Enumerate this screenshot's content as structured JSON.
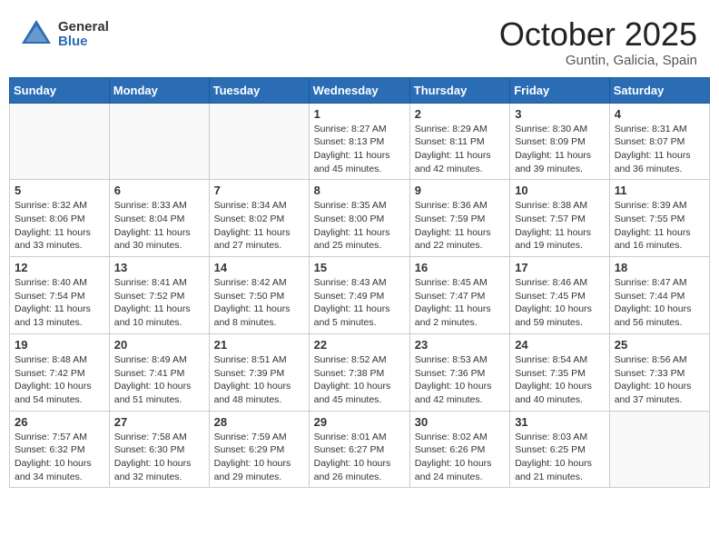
{
  "header": {
    "logo_general": "General",
    "logo_blue": "Blue",
    "month": "October 2025",
    "location": "Guntin, Galicia, Spain"
  },
  "weekdays": [
    "Sunday",
    "Monday",
    "Tuesday",
    "Wednesday",
    "Thursday",
    "Friday",
    "Saturday"
  ],
  "weeks": [
    [
      {
        "day": "",
        "info": ""
      },
      {
        "day": "",
        "info": ""
      },
      {
        "day": "",
        "info": ""
      },
      {
        "day": "1",
        "info": "Sunrise: 8:27 AM\nSunset: 8:13 PM\nDaylight: 11 hours and 45 minutes."
      },
      {
        "day": "2",
        "info": "Sunrise: 8:29 AM\nSunset: 8:11 PM\nDaylight: 11 hours and 42 minutes."
      },
      {
        "day": "3",
        "info": "Sunrise: 8:30 AM\nSunset: 8:09 PM\nDaylight: 11 hours and 39 minutes."
      },
      {
        "day": "4",
        "info": "Sunrise: 8:31 AM\nSunset: 8:07 PM\nDaylight: 11 hours and 36 minutes."
      }
    ],
    [
      {
        "day": "5",
        "info": "Sunrise: 8:32 AM\nSunset: 8:06 PM\nDaylight: 11 hours and 33 minutes."
      },
      {
        "day": "6",
        "info": "Sunrise: 8:33 AM\nSunset: 8:04 PM\nDaylight: 11 hours and 30 minutes."
      },
      {
        "day": "7",
        "info": "Sunrise: 8:34 AM\nSunset: 8:02 PM\nDaylight: 11 hours and 27 minutes."
      },
      {
        "day": "8",
        "info": "Sunrise: 8:35 AM\nSunset: 8:00 PM\nDaylight: 11 hours and 25 minutes."
      },
      {
        "day": "9",
        "info": "Sunrise: 8:36 AM\nSunset: 7:59 PM\nDaylight: 11 hours and 22 minutes."
      },
      {
        "day": "10",
        "info": "Sunrise: 8:38 AM\nSunset: 7:57 PM\nDaylight: 11 hours and 19 minutes."
      },
      {
        "day": "11",
        "info": "Sunrise: 8:39 AM\nSunset: 7:55 PM\nDaylight: 11 hours and 16 minutes."
      }
    ],
    [
      {
        "day": "12",
        "info": "Sunrise: 8:40 AM\nSunset: 7:54 PM\nDaylight: 11 hours and 13 minutes."
      },
      {
        "day": "13",
        "info": "Sunrise: 8:41 AM\nSunset: 7:52 PM\nDaylight: 11 hours and 10 minutes."
      },
      {
        "day": "14",
        "info": "Sunrise: 8:42 AM\nSunset: 7:50 PM\nDaylight: 11 hours and 8 minutes."
      },
      {
        "day": "15",
        "info": "Sunrise: 8:43 AM\nSunset: 7:49 PM\nDaylight: 11 hours and 5 minutes."
      },
      {
        "day": "16",
        "info": "Sunrise: 8:45 AM\nSunset: 7:47 PM\nDaylight: 11 hours and 2 minutes."
      },
      {
        "day": "17",
        "info": "Sunrise: 8:46 AM\nSunset: 7:45 PM\nDaylight: 10 hours and 59 minutes."
      },
      {
        "day": "18",
        "info": "Sunrise: 8:47 AM\nSunset: 7:44 PM\nDaylight: 10 hours and 56 minutes."
      }
    ],
    [
      {
        "day": "19",
        "info": "Sunrise: 8:48 AM\nSunset: 7:42 PM\nDaylight: 10 hours and 54 minutes."
      },
      {
        "day": "20",
        "info": "Sunrise: 8:49 AM\nSunset: 7:41 PM\nDaylight: 10 hours and 51 minutes."
      },
      {
        "day": "21",
        "info": "Sunrise: 8:51 AM\nSunset: 7:39 PM\nDaylight: 10 hours and 48 minutes."
      },
      {
        "day": "22",
        "info": "Sunrise: 8:52 AM\nSunset: 7:38 PM\nDaylight: 10 hours and 45 minutes."
      },
      {
        "day": "23",
        "info": "Sunrise: 8:53 AM\nSunset: 7:36 PM\nDaylight: 10 hours and 42 minutes."
      },
      {
        "day": "24",
        "info": "Sunrise: 8:54 AM\nSunset: 7:35 PM\nDaylight: 10 hours and 40 minutes."
      },
      {
        "day": "25",
        "info": "Sunrise: 8:56 AM\nSunset: 7:33 PM\nDaylight: 10 hours and 37 minutes."
      }
    ],
    [
      {
        "day": "26",
        "info": "Sunrise: 7:57 AM\nSunset: 6:32 PM\nDaylight: 10 hours and 34 minutes."
      },
      {
        "day": "27",
        "info": "Sunrise: 7:58 AM\nSunset: 6:30 PM\nDaylight: 10 hours and 32 minutes."
      },
      {
        "day": "28",
        "info": "Sunrise: 7:59 AM\nSunset: 6:29 PM\nDaylight: 10 hours and 29 minutes."
      },
      {
        "day": "29",
        "info": "Sunrise: 8:01 AM\nSunset: 6:27 PM\nDaylight: 10 hours and 26 minutes."
      },
      {
        "day": "30",
        "info": "Sunrise: 8:02 AM\nSunset: 6:26 PM\nDaylight: 10 hours and 24 minutes."
      },
      {
        "day": "31",
        "info": "Sunrise: 8:03 AM\nSunset: 6:25 PM\nDaylight: 10 hours and 21 minutes."
      },
      {
        "day": "",
        "info": ""
      }
    ]
  ]
}
